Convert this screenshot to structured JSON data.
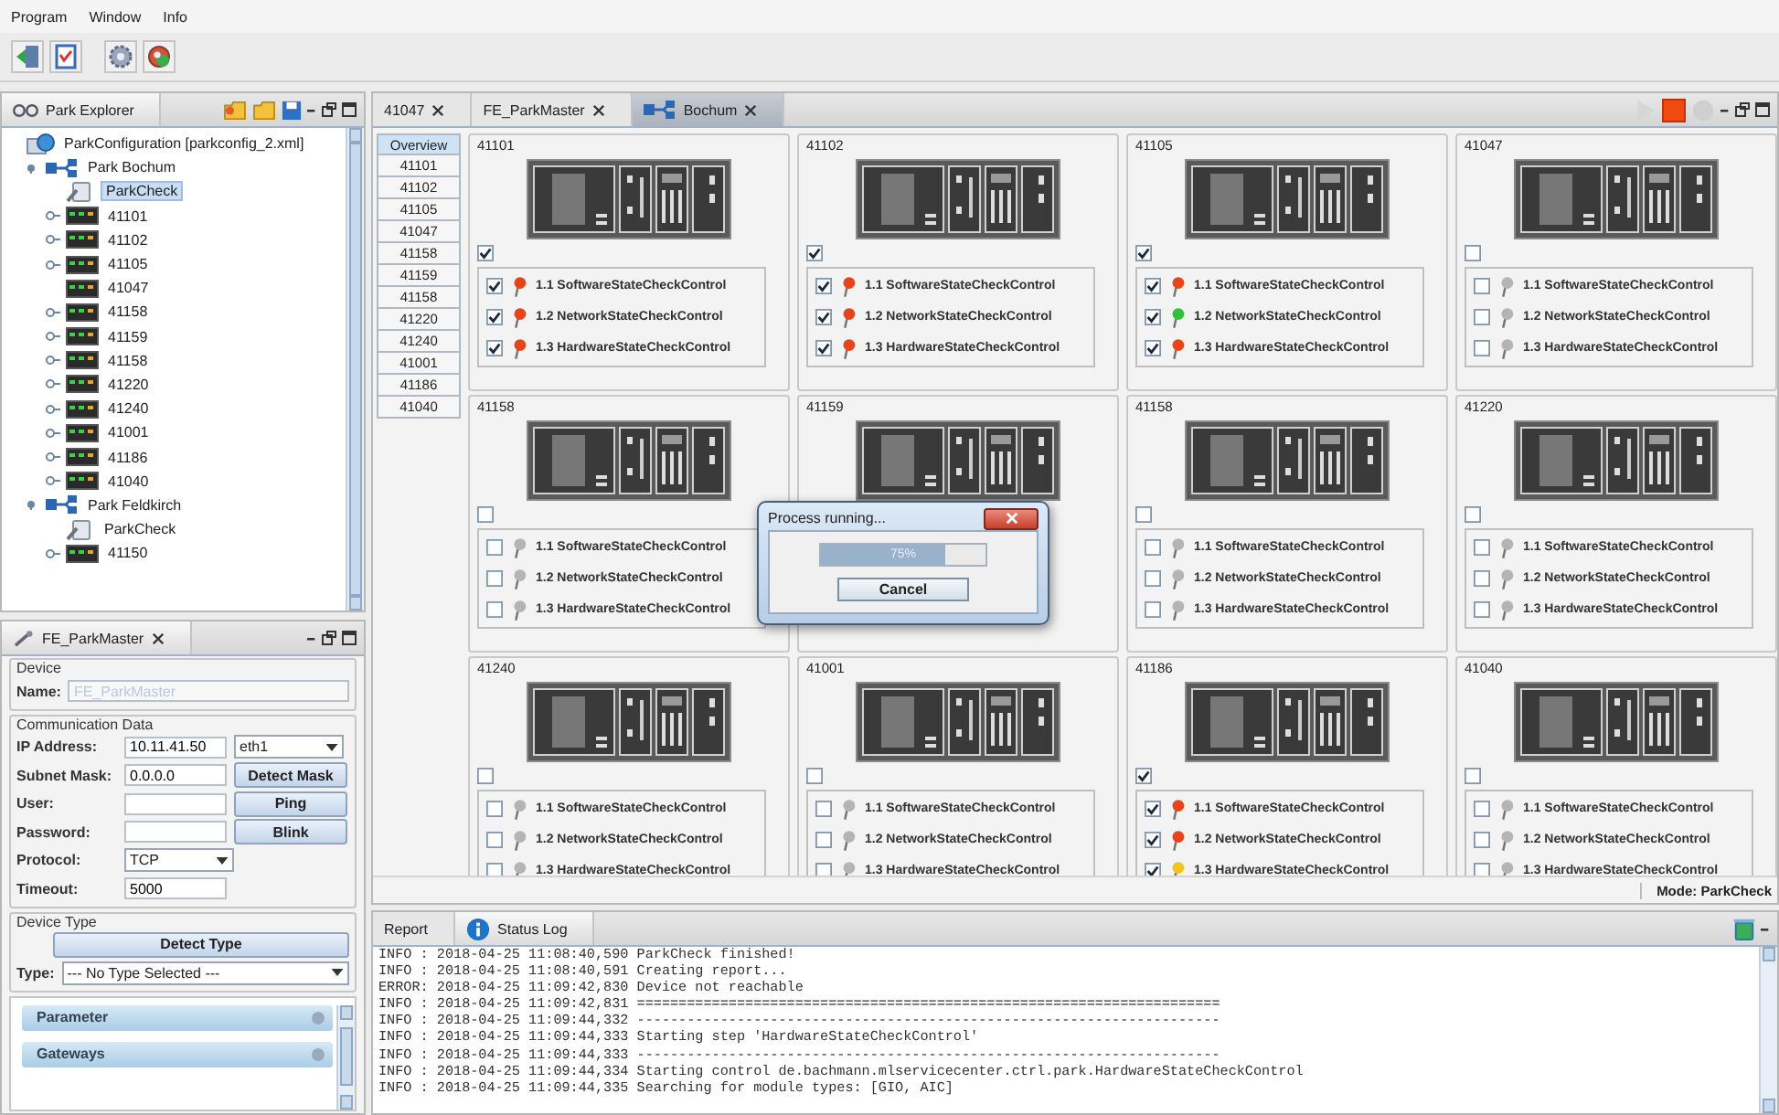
{
  "menu": [
    "Program",
    "Window",
    "Info"
  ],
  "explorer": {
    "tab": "Park Explorer",
    "tree": [
      {
        "label": "ParkConfiguration [parkconfig_2.xml]",
        "kind": "config",
        "selected": false,
        "children": [
          {
            "label": "Park Bochum",
            "kind": "park",
            "selected": false,
            "expanded": true,
            "children": [
              {
                "label": "ParkCheck",
                "kind": "check",
                "selected": true
              },
              {
                "label": "41101",
                "kind": "device",
                "selected": false,
                "expanded": false
              },
              {
                "label": "41102",
                "kind": "device",
                "selected": false,
                "expanded": false
              },
              {
                "label": "41105",
                "kind": "device",
                "selected": false,
                "expanded": false
              },
              {
                "label": "41047",
                "kind": "device",
                "selected": false
              },
              {
                "label": "41158",
                "kind": "device",
                "selected": false,
                "expanded": false
              },
              {
                "label": "41159",
                "kind": "device",
                "selected": false,
                "expanded": false
              },
              {
                "label": "41158",
                "kind": "device",
                "selected": false,
                "expanded": false
              },
              {
                "label": "41220",
                "kind": "device",
                "selected": false,
                "expanded": false
              },
              {
                "label": "41240",
                "kind": "device",
                "selected": false,
                "expanded": false
              },
              {
                "label": "41001",
                "kind": "device",
                "selected": false,
                "expanded": false
              },
              {
                "label": "41186",
                "kind": "device",
                "selected": false,
                "expanded": false
              },
              {
                "label": "41040",
                "kind": "device",
                "selected": false,
                "expanded": false
              }
            ]
          },
          {
            "label": "Park Feldkirch",
            "kind": "park",
            "selected": false,
            "expanded": true,
            "children": [
              {
                "label": "ParkCheck",
                "kind": "check",
                "selected": false
              },
              {
                "label": "41150",
                "kind": "device",
                "selected": false,
                "expanded": false
              }
            ]
          }
        ]
      }
    ]
  },
  "device_panel": {
    "tab": "FE_ParkMaster",
    "device": {
      "legend": "Device",
      "name_label": "Name:",
      "name_value": "FE_ParkMaster",
      "disabled": true
    },
    "comm": {
      "legend": "Communication Data",
      "rows": [
        {
          "label": "IP Address:",
          "field": {
            "kind": "text",
            "value": "10.11.41.50"
          },
          "side": {
            "kind": "select",
            "text": "eth1"
          }
        },
        {
          "label": "Subnet Mask:",
          "field": {
            "kind": "text",
            "value": "0.0.0.0"
          },
          "side": {
            "kind": "button",
            "text": "Detect Mask"
          }
        },
        {
          "label": "User:",
          "field": {
            "kind": "text"
          },
          "side": {
            "kind": "button",
            "text": "Ping"
          }
        },
        {
          "label": "Password:",
          "field": {
            "kind": "text"
          },
          "side": {
            "kind": "button",
            "text": "Blink"
          }
        },
        {
          "label": "Protocol:",
          "field": {
            "kind": "select",
            "value": "TCP"
          }
        },
        {
          "label": "Timeout:",
          "field": {
            "kind": "text",
            "value": "5000"
          }
        }
      ]
    },
    "device_type": {
      "legend": "Device Type",
      "button": "Detect Type",
      "label": "Type:",
      "value": "--- No Type Selected ---"
    },
    "sections": [
      "Parameter",
      "Gateways"
    ]
  },
  "editor_tabs": [
    {
      "label": "41047",
      "kind": "plain",
      "selected": false
    },
    {
      "label": "FE_ParkMaster",
      "kind": "plain",
      "selected": false
    },
    {
      "label": "Bochum",
      "kind": "park",
      "selected": true
    }
  ],
  "overview": [
    {
      "label": "Overview",
      "selected": true
    },
    {
      "label": "41101",
      "selected": false
    },
    {
      "label": "41102",
      "selected": false
    },
    {
      "label": "41105",
      "selected": false
    },
    {
      "label": "41047",
      "selected": false
    },
    {
      "label": "41158",
      "selected": false
    },
    {
      "label": "41159",
      "selected": false
    },
    {
      "label": "41158",
      "selected": false
    },
    {
      "label": "41220",
      "selected": false
    },
    {
      "label": "41240",
      "selected": false
    },
    {
      "label": "41001",
      "selected": false
    },
    {
      "label": "41186",
      "selected": false
    },
    {
      "label": "41040",
      "selected": false
    }
  ],
  "cards": [
    {
      "title": "41101",
      "checked": true,
      "controls": [
        {
          "label": "1.1 SoftwareStateCheckControl",
          "checked": true,
          "color": "#e8441c"
        },
        {
          "label": "1.2 NetworkStateCheckControl",
          "checked": true,
          "color": "#e8441c"
        },
        {
          "label": "1.3 HardwareStateCheckControl",
          "checked": true,
          "color": "#e8441c"
        }
      ]
    },
    {
      "title": "41102",
      "checked": true,
      "controls": [
        {
          "label": "1.1 SoftwareStateCheckControl",
          "checked": true,
          "color": "#e8441c"
        },
        {
          "label": "1.2 NetworkStateCheckControl",
          "checked": true,
          "color": "#e8441c"
        },
        {
          "label": "1.3 HardwareStateCheckControl",
          "checked": true,
          "color": "#e8441c"
        }
      ]
    },
    {
      "title": "41105",
      "checked": true,
      "controls": [
        {
          "label": "1.1 SoftwareStateCheckControl",
          "checked": true,
          "color": "#e8441c"
        },
        {
          "label": "1.2 NetworkStateCheckControl",
          "checked": true,
          "color": "#2fc23a"
        },
        {
          "label": "1.3 HardwareStateCheckControl",
          "checked": true,
          "color": "#e8441c"
        }
      ]
    },
    {
      "title": "41047",
      "checked": false,
      "controls": [
        {
          "label": "1.1 SoftwareStateCheckControl",
          "checked": false,
          "color": "#b4b4b4"
        },
        {
          "label": "1.2 NetworkStateCheckControl",
          "checked": false,
          "color": "#b4b4b4"
        },
        {
          "label": "1.3 HardwareStateCheckControl",
          "checked": false,
          "color": "#b4b4b4"
        }
      ]
    },
    {
      "title": "41158",
      "checked": false,
      "controls": [
        {
          "label": "1.1 SoftwareStateCheckControl",
          "checked": false,
          "color": "#b4b4b4"
        },
        {
          "label": "1.2 NetworkStateCheckControl",
          "checked": false,
          "color": "#b4b4b4"
        },
        {
          "label": "1.3 HardwareStateCheckControl",
          "checked": false,
          "color": "#b4b4b4"
        }
      ]
    },
    {
      "title": "41159"
    },
    {
      "title": "41158",
      "checked": false,
      "controls": [
        {
          "label": "1.1 SoftwareStateCheckControl",
          "checked": false,
          "color": "#b4b4b4"
        },
        {
          "label": "1.2 NetworkStateCheckControl",
          "checked": false,
          "color": "#b4b4b4"
        },
        {
          "label": "1.3 HardwareStateCheckControl",
          "checked": false,
          "color": "#b4b4b4"
        }
      ]
    },
    {
      "title": "41220",
      "checked": false,
      "controls": [
        {
          "label": "1.1 SoftwareStateCheckControl",
          "checked": false,
          "color": "#b4b4b4"
        },
        {
          "label": "1.2 NetworkStateCheckControl",
          "checked": false,
          "color": "#b4b4b4"
        },
        {
          "label": "1.3 HardwareStateCheckControl",
          "checked": false,
          "color": "#b4b4b4"
        }
      ]
    },
    {
      "title": "41240",
      "checked": false,
      "controls": [
        {
          "label": "1.1 SoftwareStateCheckControl",
          "checked": false,
          "color": "#b4b4b4"
        },
        {
          "label": "1.2 NetworkStateCheckControl",
          "checked": false,
          "color": "#b4b4b4"
        },
        {
          "label": "1.3 HardwareStateCheckControl",
          "checked": false,
          "color": "#b4b4b4"
        }
      ]
    },
    {
      "title": "41001",
      "checked": false,
      "controls": [
        {
          "label": "1.1 SoftwareStateCheckControl",
          "checked": false,
          "color": "#b4b4b4"
        },
        {
          "label": "1.2 NetworkStateCheckControl",
          "checked": false,
          "color": "#b4b4b4"
        },
        {
          "label": "1.3 HardwareStateCheckControl",
          "checked": false,
          "color": "#b4b4b4"
        }
      ]
    },
    {
      "title": "41186",
      "checked": true,
      "controls": [
        {
          "label": "1.1 SoftwareStateCheckControl",
          "checked": true,
          "color": "#e8441c"
        },
        {
          "label": "1.2 NetworkStateCheckControl",
          "checked": true,
          "color": "#e8441c"
        },
        {
          "label": "1.3 HardwareStateCheckControl",
          "checked": true,
          "color": "#f2c21e"
        }
      ]
    },
    {
      "title": "41040",
      "checked": false,
      "controls": [
        {
          "label": "1.1 SoftwareStateCheckControl",
          "checked": false,
          "color": "#b4b4b4"
        },
        {
          "label": "1.2 NetworkStateCheckControl",
          "checked": false,
          "color": "#b4b4b4"
        },
        {
          "label": "1.3 HardwareStateCheckControl",
          "checked": false,
          "color": "#b4b4b4"
        }
      ]
    }
  ],
  "mode": "Mode: ParkCheck",
  "dialog": {
    "title": "Process running...",
    "level": 0.75,
    "reading": "75%",
    "button": "Cancel"
  },
  "bottom_tabs": [
    {
      "label": "Report",
      "kind": "plain",
      "selected": false
    },
    {
      "label": "Status Log",
      "kind": "info",
      "selected": true
    }
  ],
  "log": [
    "INFO : 2018-04-25 11:08:40,590 ParkCheck finished!",
    "INFO : 2018-04-25 11:08:40,591 Creating report...",
    "ERROR: 2018-04-25 11:09:42,830 Device not reachable",
    "INFO : 2018-04-25 11:09:42,831 ======================================================================",
    "INFO : 2018-04-25 11:09:44,332 ----------------------------------------------------------------------",
    "INFO : 2018-04-25 11:09:44,333 Starting step 'HardwareStateCheckControl'",
    "INFO : 2018-04-25 11:09:44,333 ----------------------------------------------------------------------",
    "INFO : 2018-04-25 11:09:44,334 Starting control de.bachmann.mlservicecenter.ctrl.park.HardwareStateCheckControl",
    "INFO : 2018-04-25 11:09:44,335 Searching for module types: [GIO, AIC]"
  ]
}
